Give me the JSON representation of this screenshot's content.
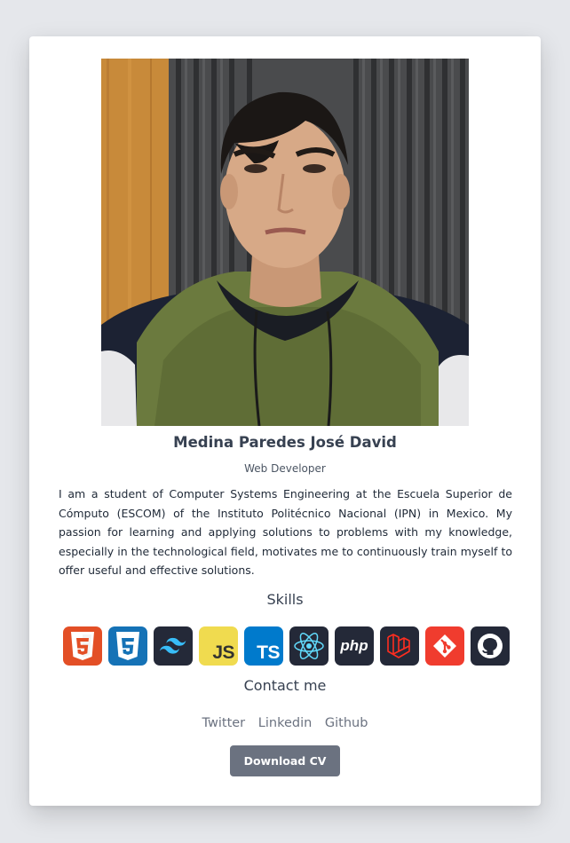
{
  "profile": {
    "name": "Medina Paredes José David",
    "role": "Web Developer",
    "bio": "I am a student of Computer Systems Engineering at the Escuela Superior de Cómputo (ESCOM) of the Instituto Politécnico Nacional (IPN) in Mexico. My passion for learning and applying solutions to problems with my knowledge, especially in the technological field, motivates me to continuously train myself to offer useful and effective solutions."
  },
  "skills": {
    "title": "Skills",
    "items": [
      {
        "icon": "html5-icon",
        "color": "#e34f26"
      },
      {
        "icon": "css3-icon",
        "color": "#1572b6"
      },
      {
        "icon": "tailwind-icon",
        "color": "#242938"
      },
      {
        "icon": "javascript-icon",
        "color": "#f0db4f",
        "label": "JS"
      },
      {
        "icon": "typescript-icon",
        "color": "#007acc",
        "label": "TS"
      },
      {
        "icon": "react-icon",
        "color": "#242938"
      },
      {
        "icon": "php-icon",
        "color": "#242938",
        "label": "php"
      },
      {
        "icon": "laravel-icon",
        "color": "#242938"
      },
      {
        "icon": "git-icon",
        "color": "#f03c2e"
      },
      {
        "icon": "github-icon",
        "color": "#242938"
      }
    ]
  },
  "contact": {
    "title": "Contact me",
    "links": [
      "Twitter",
      "Linkedin",
      "Github"
    ],
    "download_label": "Download CV"
  }
}
